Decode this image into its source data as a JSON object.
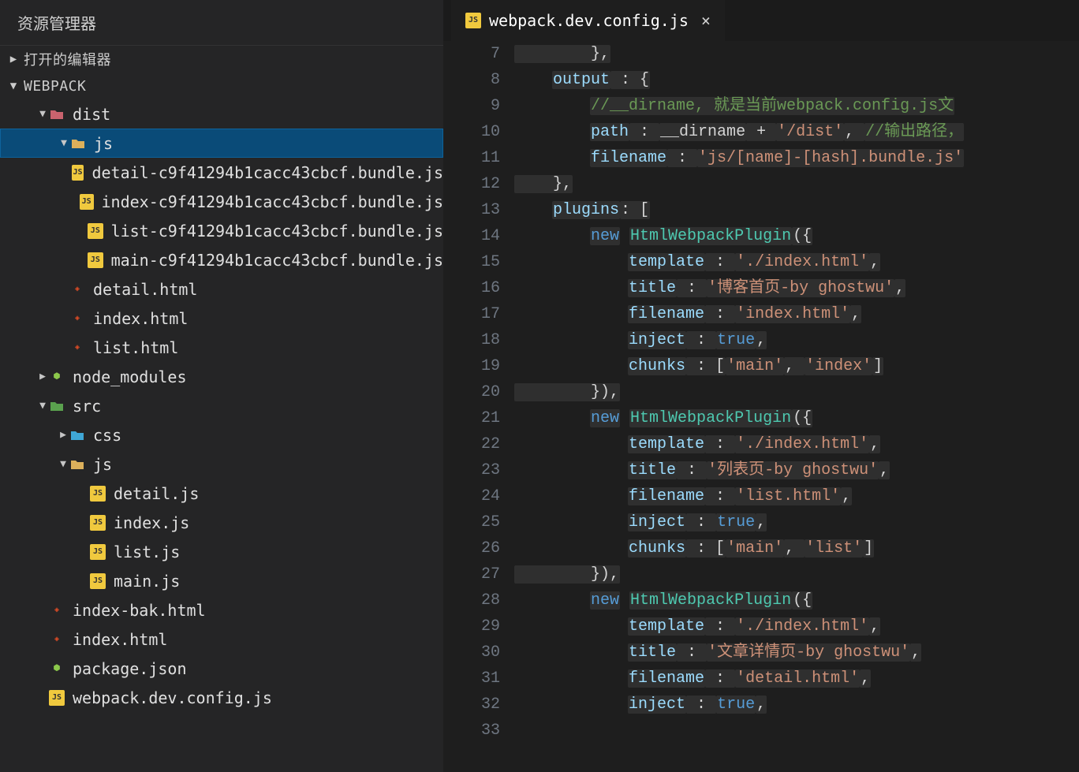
{
  "explorer": {
    "title": "资源管理器",
    "openEditorsLabel": "打开的编辑器",
    "projectLabel": "WEBPACK"
  },
  "tree": [
    {
      "depth": 1,
      "chev": "down",
      "icon": "folder-red",
      "iconText": "",
      "label": "dist",
      "name": "folder-dist"
    },
    {
      "depth": 2,
      "chev": "down",
      "icon": "folder-yellow",
      "iconText": "",
      "label": "js",
      "name": "folder-dist-js",
      "selected": true
    },
    {
      "depth": 3,
      "chev": "",
      "icon": "js",
      "iconText": "JS",
      "label": "detail-c9f41294b1cacc43cbcf.bundle.js",
      "name": "file-detail-bundle"
    },
    {
      "depth": 3,
      "chev": "",
      "icon": "js",
      "iconText": "JS",
      "label": "index-c9f41294b1cacc43cbcf.bundle.js",
      "name": "file-index-bundle"
    },
    {
      "depth": 3,
      "chev": "",
      "icon": "js",
      "iconText": "JS",
      "label": "list-c9f41294b1cacc43cbcf.bundle.js",
      "name": "file-list-bundle"
    },
    {
      "depth": 3,
      "chev": "",
      "icon": "js",
      "iconText": "JS",
      "label": "main-c9f41294b1cacc43cbcf.bundle.js",
      "name": "file-main-bundle"
    },
    {
      "depth": 2,
      "chev": "",
      "icon": "html",
      "iconText": "◈",
      "label": "detail.html",
      "name": "file-detail-html"
    },
    {
      "depth": 2,
      "chev": "",
      "icon": "html",
      "iconText": "◈",
      "label": "index.html",
      "name": "file-dist-index-html"
    },
    {
      "depth": 2,
      "chev": "",
      "icon": "html",
      "iconText": "◈",
      "label": "list.html",
      "name": "file-list-html"
    },
    {
      "depth": 1,
      "chev": "right",
      "icon": "node",
      "iconText": "⬢",
      "label": "node_modules",
      "name": "folder-node-modules"
    },
    {
      "depth": 1,
      "chev": "down",
      "icon": "folder-green",
      "iconText": "",
      "label": "src",
      "name": "folder-src"
    },
    {
      "depth": 2,
      "chev": "right",
      "icon": "folder-blue",
      "iconText": "",
      "label": "css",
      "name": "folder-css"
    },
    {
      "depth": 2,
      "chev": "down",
      "icon": "folder-yellow",
      "iconText": "",
      "label": "js",
      "name": "folder-src-js"
    },
    {
      "depth": 3,
      "chev": "",
      "icon": "js",
      "iconText": "JS",
      "label": "detail.js",
      "name": "file-detail-js"
    },
    {
      "depth": 3,
      "chev": "",
      "icon": "js",
      "iconText": "JS",
      "label": "index.js",
      "name": "file-index-js"
    },
    {
      "depth": 3,
      "chev": "",
      "icon": "js",
      "iconText": "JS",
      "label": "list.js",
      "name": "file-list-js"
    },
    {
      "depth": 3,
      "chev": "",
      "icon": "js",
      "iconText": "JS",
      "label": "main.js",
      "name": "file-main-js"
    },
    {
      "depth": 1,
      "chev": "",
      "icon": "html",
      "iconText": "◈",
      "label": "index-bak.html",
      "name": "file-index-bak-html"
    },
    {
      "depth": 1,
      "chev": "",
      "icon": "html",
      "iconText": "◈",
      "label": "index.html",
      "name": "file-root-index-html"
    },
    {
      "depth": 1,
      "chev": "",
      "icon": "node",
      "iconText": "⬢",
      "label": "package.json",
      "name": "file-package-json"
    },
    {
      "depth": 1,
      "chev": "",
      "icon": "js",
      "iconText": "JS",
      "label": "webpack.dev.config.js",
      "name": "file-webpack-config"
    }
  ],
  "tab": {
    "iconText": "JS",
    "label": "webpack.dev.config.js"
  },
  "gutterStart": 7,
  "gutterEnd": 33,
  "code": [
    [
      {
        "t": "",
        "txt": "        },"
      }
    ],
    [
      {
        "t": "",
        "txt": "    "
      },
      {
        "t": "prop",
        "txt": "output"
      },
      {
        "t": "",
        "txt": " : {"
      }
    ],
    [
      {
        "t": "",
        "txt": "        "
      },
      {
        "t": "comm",
        "txt": "//__dirname, 就是当前webpack.config.js文"
      }
    ],
    [
      {
        "t": "",
        "txt": "        "
      },
      {
        "t": "prop",
        "txt": "path"
      },
      {
        "t": "",
        "txt": " : "
      },
      {
        "t": "var",
        "txt": "__dirname"
      },
      {
        "t": "",
        "txt": " + "
      },
      {
        "t": "str",
        "txt": "'/dist'"
      },
      {
        "t": "",
        "txt": ", "
      },
      {
        "t": "comm",
        "txt": "//输出路径，"
      }
    ],
    [
      {
        "t": "",
        "txt": "        "
      },
      {
        "t": "prop",
        "txt": "filename"
      },
      {
        "t": "",
        "txt": " : "
      },
      {
        "t": "str",
        "txt": "'js/[name]-[hash].bundle.js'"
      }
    ],
    [
      {
        "t": "",
        "txt": "    },"
      }
    ],
    [
      {
        "t": "",
        "txt": "    "
      },
      {
        "t": "prop",
        "txt": "plugins"
      },
      {
        "t": "",
        "txt": ": ["
      }
    ],
    [
      {
        "t": "",
        "txt": "        "
      },
      {
        "t": "key",
        "txt": "new"
      },
      {
        "t": "",
        "txt": " "
      },
      {
        "t": "type",
        "txt": "HtmlWebpackPlugin"
      },
      {
        "t": "",
        "txt": "({"
      }
    ],
    [
      {
        "t": "",
        "txt": "            "
      },
      {
        "t": "prop",
        "txt": "template"
      },
      {
        "t": "",
        "txt": " : "
      },
      {
        "t": "str",
        "txt": "'./index.html'"
      },
      {
        "t": "",
        "txt": ","
      }
    ],
    [
      {
        "t": "",
        "txt": "            "
      },
      {
        "t": "prop",
        "txt": "title"
      },
      {
        "t": "",
        "txt": " : "
      },
      {
        "t": "str",
        "txt": "'博客首页-by ghostwu'"
      },
      {
        "t": "",
        "txt": ","
      }
    ],
    [
      {
        "t": "",
        "txt": "            "
      },
      {
        "t": "prop",
        "txt": "filename"
      },
      {
        "t": "",
        "txt": " : "
      },
      {
        "t": "str",
        "txt": "'index.html'"
      },
      {
        "t": "",
        "txt": ","
      }
    ],
    [
      {
        "t": "",
        "txt": "            "
      },
      {
        "t": "prop",
        "txt": "inject"
      },
      {
        "t": "",
        "txt": " : "
      },
      {
        "t": "const",
        "txt": "true"
      },
      {
        "t": "",
        "txt": ","
      }
    ],
    [
      {
        "t": "",
        "txt": "            "
      },
      {
        "t": "prop",
        "txt": "chunks"
      },
      {
        "t": "",
        "txt": " : ["
      },
      {
        "t": "str",
        "txt": "'main'"
      },
      {
        "t": "",
        "txt": ", "
      },
      {
        "t": "str",
        "txt": "'index'"
      },
      {
        "t": "",
        "txt": "]"
      }
    ],
    [
      {
        "t": "",
        "txt": "        }),"
      }
    ],
    [
      {
        "t": "",
        "txt": "        "
      },
      {
        "t": "key",
        "txt": "new"
      },
      {
        "t": "",
        "txt": " "
      },
      {
        "t": "type",
        "txt": "HtmlWebpackPlugin"
      },
      {
        "t": "",
        "txt": "({"
      }
    ],
    [
      {
        "t": "",
        "txt": "            "
      },
      {
        "t": "prop",
        "txt": "template"
      },
      {
        "t": "",
        "txt": " : "
      },
      {
        "t": "str",
        "txt": "'./index.html'"
      },
      {
        "t": "",
        "txt": ","
      }
    ],
    [
      {
        "t": "",
        "txt": "            "
      },
      {
        "t": "prop",
        "txt": "title"
      },
      {
        "t": "",
        "txt": " : "
      },
      {
        "t": "str",
        "txt": "'列表页-by ghostwu'"
      },
      {
        "t": "",
        "txt": ","
      }
    ],
    [
      {
        "t": "",
        "txt": "            "
      },
      {
        "t": "prop",
        "txt": "filename"
      },
      {
        "t": "",
        "txt": " : "
      },
      {
        "t": "str",
        "txt": "'list.html'"
      },
      {
        "t": "",
        "txt": ","
      }
    ],
    [
      {
        "t": "",
        "txt": "            "
      },
      {
        "t": "prop",
        "txt": "inject"
      },
      {
        "t": "",
        "txt": " : "
      },
      {
        "t": "const",
        "txt": "true"
      },
      {
        "t": "",
        "txt": ","
      }
    ],
    [
      {
        "t": "",
        "txt": "            "
      },
      {
        "t": "prop",
        "txt": "chunks"
      },
      {
        "t": "",
        "txt": " : ["
      },
      {
        "t": "str",
        "txt": "'main'"
      },
      {
        "t": "",
        "txt": ", "
      },
      {
        "t": "str",
        "txt": "'list'"
      },
      {
        "t": "",
        "txt": "]"
      }
    ],
    [
      {
        "t": "",
        "txt": "        }),"
      }
    ],
    [
      {
        "t": "",
        "txt": "        "
      },
      {
        "t": "key",
        "txt": "new"
      },
      {
        "t": "",
        "txt": " "
      },
      {
        "t": "type",
        "txt": "HtmlWebpackPlugin"
      },
      {
        "t": "",
        "txt": "({"
      }
    ],
    [
      {
        "t": "",
        "txt": "            "
      },
      {
        "t": "prop",
        "txt": "template"
      },
      {
        "t": "",
        "txt": " : "
      },
      {
        "t": "str",
        "txt": "'./index.html'"
      },
      {
        "t": "",
        "txt": ","
      }
    ],
    [
      {
        "t": "",
        "txt": "            "
      },
      {
        "t": "prop",
        "txt": "title"
      },
      {
        "t": "",
        "txt": " : "
      },
      {
        "t": "str",
        "txt": "'文章详情页-by ghostwu'"
      },
      {
        "t": "",
        "txt": ","
      }
    ],
    [
      {
        "t": "",
        "txt": "            "
      },
      {
        "t": "prop",
        "txt": "filename"
      },
      {
        "t": "",
        "txt": " : "
      },
      {
        "t": "str",
        "txt": "'detail.html'"
      },
      {
        "t": "",
        "txt": ","
      }
    ],
    [
      {
        "t": "",
        "txt": "            "
      },
      {
        "t": "prop",
        "txt": "inject"
      },
      {
        "t": "",
        "txt": " : "
      },
      {
        "t": "const",
        "txt": "true"
      },
      {
        "t": "",
        "txt": ","
      }
    ],
    [
      {
        "t": "",
        "txt": ""
      }
    ]
  ]
}
